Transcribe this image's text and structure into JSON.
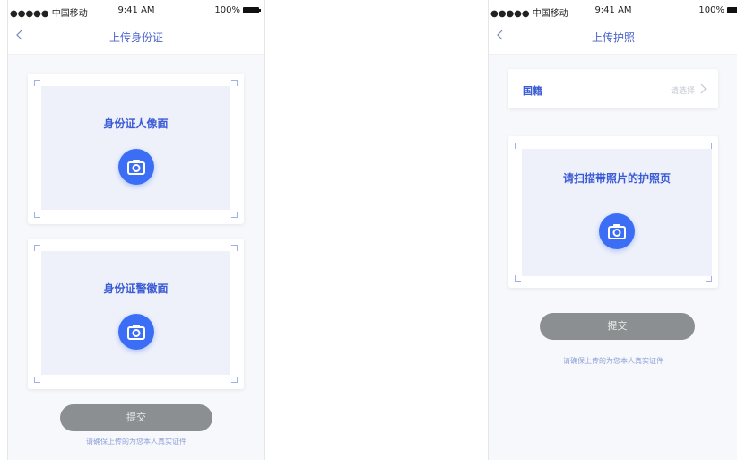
{
  "status_bar": {
    "carrier": "●●●●● 中国移动",
    "time": "9:41 AM",
    "battery": "100%"
  },
  "left_screen": {
    "title": "上传身份证",
    "front_label": "身份证人像面",
    "back_label": "身份证警徽面",
    "submit_label": "提交",
    "hint": "请确保上传的为您本人真实证件"
  },
  "right_screen": {
    "title": "上传护照",
    "nationality_label": "国籍",
    "nationality_placeholder": "请选择",
    "scan_label": "请扫描带照片的护照页",
    "submit_label": "提交",
    "hint": "请确保上传的为您本人真实证件"
  },
  "icons": {
    "back": "chevron-left-icon",
    "camera": "camera-icon",
    "chevron_right": "chevron-right-icon",
    "battery": "battery-icon"
  },
  "colors": {
    "accent": "#3b6ef5",
    "title_blue": "#4a63c8",
    "label_blue": "#3b5bd6",
    "submit_disabled": "#8c8f91",
    "scan_bg": "#eef1fa",
    "hint": "#8ea0d8"
  }
}
